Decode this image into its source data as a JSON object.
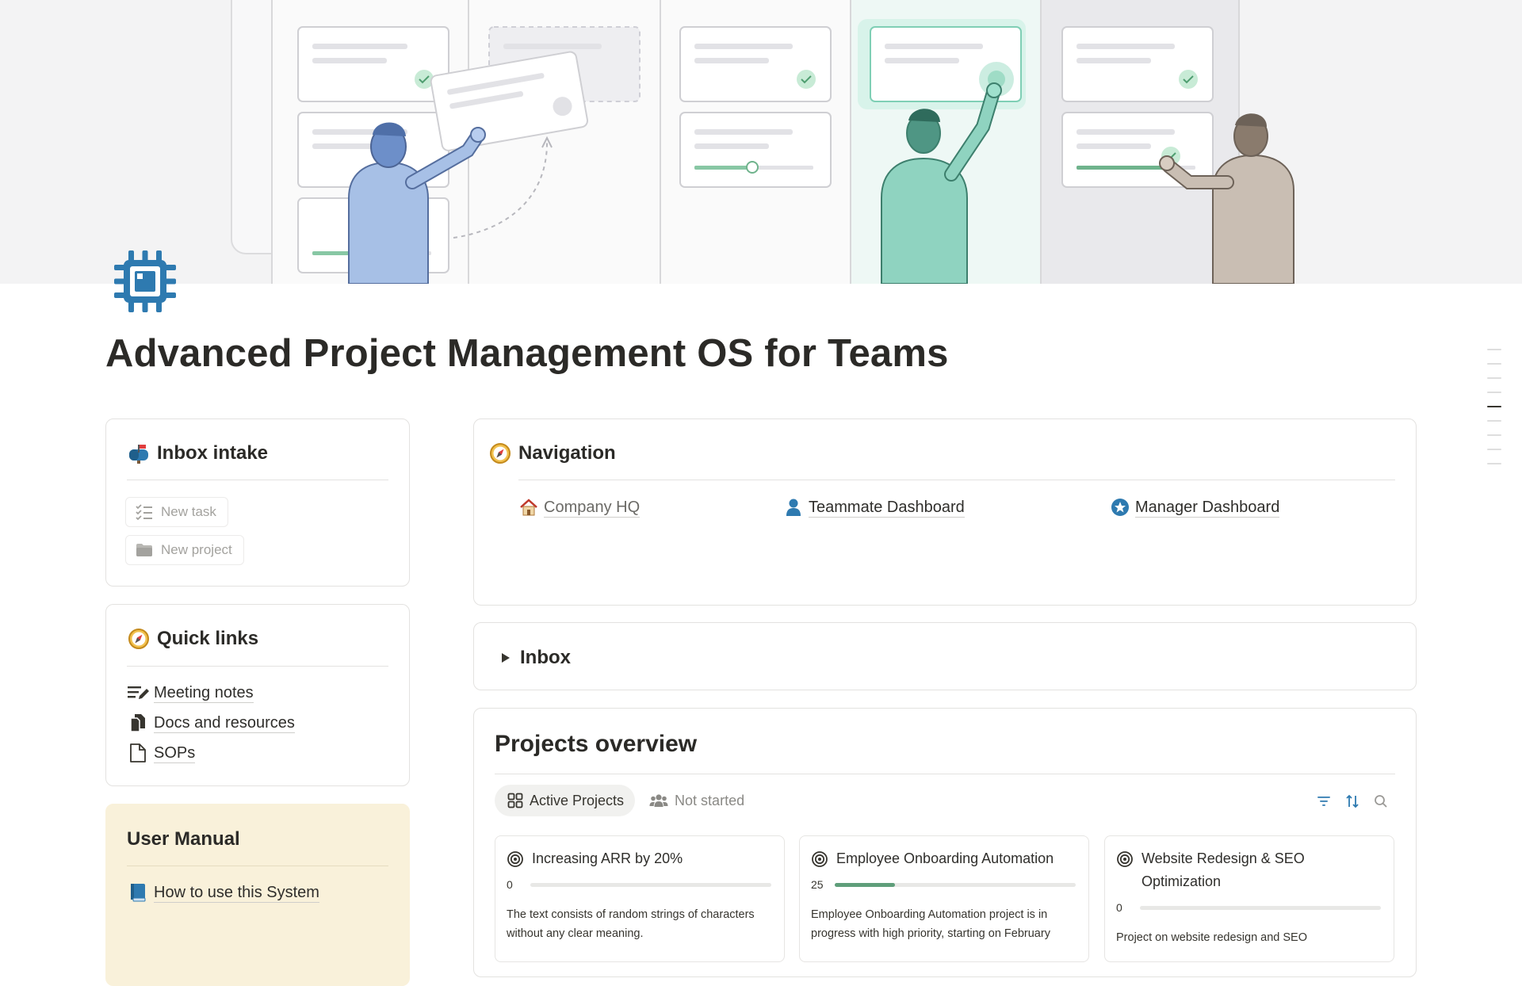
{
  "page": {
    "title": "Advanced Project Management OS for Teams",
    "icon": "chip-icon"
  },
  "colors": {
    "accent_blue": "#2e7ab0",
    "progress_green": "#5f9e7a",
    "user_manual_bg": "#f9f1da"
  },
  "inbox_intake": {
    "heading": "Inbox intake",
    "icon": "mailbox-icon",
    "buttons": [
      {
        "label": "New task",
        "icon": "checklist-icon"
      },
      {
        "label": "New project",
        "icon": "folder-icon"
      }
    ]
  },
  "quick_links": {
    "heading": "Quick links",
    "icon": "compass-icon",
    "items": [
      {
        "label": "Meeting notes",
        "icon": "notes-pen-icon"
      },
      {
        "label": "Docs and resources",
        "icon": "docs-icon"
      },
      {
        "label": "SOPs",
        "icon": "document-icon"
      }
    ]
  },
  "user_manual": {
    "heading": "User Manual",
    "items": [
      {
        "label": "How to use this System",
        "icon": "book-icon"
      }
    ]
  },
  "navigation": {
    "heading": "Navigation",
    "icon": "compass-icon",
    "links": [
      {
        "label": "Company HQ",
        "icon": "house-icon"
      },
      {
        "label": "Teammate Dashboard",
        "icon": "person-icon"
      },
      {
        "label": "Manager Dashboard",
        "icon": "star-badge-icon"
      }
    ]
  },
  "inbox_toggle": {
    "label": "Inbox",
    "expanded": false
  },
  "projects_overview": {
    "heading": "Projects overview",
    "tabs": [
      {
        "label": "Active Projects",
        "icon": "grid-icon",
        "active": true
      },
      {
        "label": "Not started",
        "icon": "people-icon",
        "active": false
      }
    ],
    "tools": [
      "filter-icon",
      "sort-icon",
      "search-icon"
    ],
    "projects": [
      {
        "title": "Increasing ARR by 20%",
        "progress": 0,
        "description": "The text consists of random strings of characters without any clear meaning."
      },
      {
        "title": "Employee Onboarding Automation",
        "progress": 25,
        "description": "Employee Onboarding Automation project is in progress with high priority, starting on February"
      },
      {
        "title": "Website Redesign & SEO Optimization",
        "progress": 0,
        "description": "Project on website redesign and SEO"
      }
    ]
  }
}
